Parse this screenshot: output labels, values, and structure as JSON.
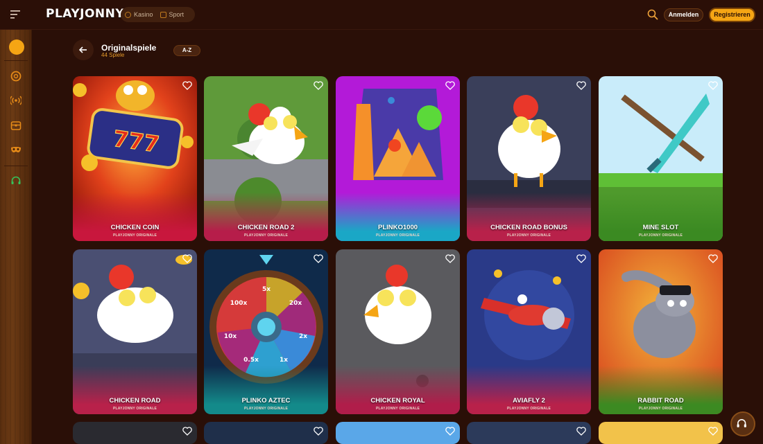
{
  "header": {
    "logo": "PLAYJONNY",
    "nav": [
      {
        "label": "Kasino",
        "icon": "casino-chip-icon"
      },
      {
        "label": "Sport",
        "icon": "sport-icon"
      }
    ],
    "login_label": "Anmelden",
    "register_label": "Registrieren"
  },
  "sidebar": {
    "items": [
      {
        "icon": "originals-logo-icon"
      },
      {
        "icon": "casino-chip-icon"
      },
      {
        "icon": "live-broadcast-icon"
      },
      {
        "icon": "treasure-chest-icon"
      },
      {
        "icon": "mask-icon"
      },
      {
        "icon": "support-headset-icon"
      }
    ]
  },
  "page": {
    "title": "Originalspiele",
    "count": "44 Spiele",
    "sort_label": "A-Z"
  },
  "games": [
    {
      "title": "CHICKEN COIN",
      "subtitle": "PLAYJONNY ORIGINALE"
    },
    {
      "title": "CHICKEN ROAD 2",
      "subtitle": "PLAYJONNY ORIGINALE"
    },
    {
      "title": "PLINKO1000",
      "subtitle": "PLAYJONNY ORIGINALE"
    },
    {
      "title": "CHICKEN ROAD BONUS",
      "subtitle": "PLAYJONNY ORIGINALE"
    },
    {
      "title": "MINE SLOT",
      "subtitle": "PLAYJONNY ORIGINALE"
    },
    {
      "title": "CHICKEN ROAD",
      "subtitle": "PLAYJONNY ORIGINALE"
    },
    {
      "title": "PLINKO AZTEC",
      "subtitle": "PLAYJONNY ORIGINALE"
    },
    {
      "title": "CHICKEN ROYAL",
      "subtitle": "PLAYJONNY ORIGINALE"
    },
    {
      "title": "AVIAFLY 2",
      "subtitle": "PLAYJONNY ORIGINALE"
    },
    {
      "title": "RABBIT ROAD",
      "subtitle": "PLAYJONNY ORIGINALE"
    }
  ],
  "wheel_labels": [
    "5x",
    "20x",
    "2x",
    "1x",
    "0.5x",
    "10x",
    "100x"
  ],
  "colors": {
    "accent": "#f5a514",
    "background": "#2a0f07",
    "count_text": "#e79b2a"
  }
}
